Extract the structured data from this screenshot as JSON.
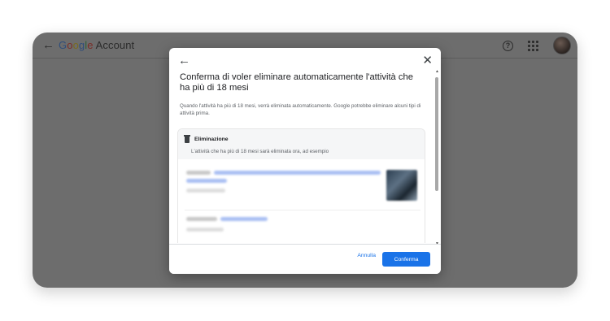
{
  "topbar": {
    "back_symbol": "←",
    "brand_g": "G",
    "brand_o1": "o",
    "brand_o2": "o",
    "brand_g2": "g",
    "brand_l": "l",
    "brand_e": "e",
    "account_label": "Account",
    "help_symbol": "?",
    "icons": [
      "arrow-back-icon",
      "help-icon",
      "apps-icon",
      "avatar"
    ]
  },
  "dialog": {
    "back_symbol": "←",
    "close_symbol": "✕",
    "title": "Conferma di voler eliminare automaticamente l'attività che ha più di 18 mesi",
    "description": "Quando l'attività ha più di 18 mesi, verrà eliminata automaticamente. Google potrebbe eliminare alcuni tipi di attività prima.",
    "card": {
      "title": "Eliminazione",
      "subtitle": "L'attività che ha più di 18 mesi sarà eliminata ora, ad esempio"
    },
    "scroll_up": "▲",
    "scroll_down": "▼",
    "cancel_label": "Annulla",
    "confirm_label": "Conferma"
  },
  "colors": {
    "accent": "#1a73e8",
    "overlay": "#6d6d6d",
    "blurred_link": "#a9bff3"
  }
}
